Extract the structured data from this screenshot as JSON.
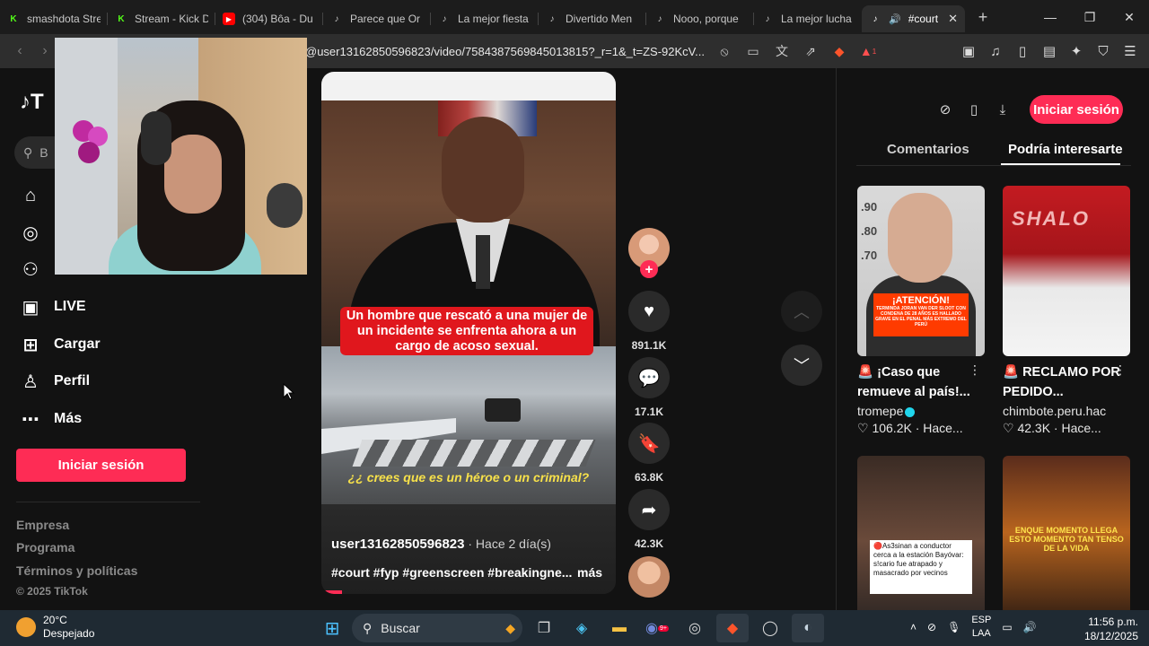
{
  "browser": {
    "tabs": [
      {
        "title": "smashdota Stre",
        "favicon": "kick-icon",
        "color": "#53fc18"
      },
      {
        "title": "Stream - Kick D",
        "favicon": "kick-icon",
        "color": "#53fc18"
      },
      {
        "title": "(304) Bôa - Du",
        "favicon": "youtube-icon",
        "color": "#ff0000"
      },
      {
        "title": "Parece que Or",
        "favicon": "tiktok-icon",
        "color": "#ffffff"
      },
      {
        "title": "La mejor fiesta",
        "favicon": "tiktok-icon",
        "color": "#ffffff"
      },
      {
        "title": "Divertido Men",
        "favicon": "tiktok-icon",
        "color": "#ffffff"
      },
      {
        "title": "Nooo, porque",
        "favicon": "tiktok-icon",
        "color": "#ffffff"
      },
      {
        "title": "La mejor lucha",
        "favicon": "tiktok-icon",
        "color": "#ffffff"
      }
    ],
    "active_tab": {
      "title": "#court",
      "close": "✕"
    },
    "new_tab": "+",
    "url": "@user13162850596823/video/7584387569845013815?_r=1&_t=ZS-92KcV...",
    "brave_badge": "1"
  },
  "sidebar": {
    "logo": "T",
    "search_placeholder": "B",
    "items": [
      {
        "label": "",
        "icon": "home-icon"
      },
      {
        "label": "",
        "icon": "compass-icon"
      },
      {
        "label": "",
        "icon": "following-icon"
      },
      {
        "label": "LIVE",
        "icon": "live-icon"
      },
      {
        "label": "Cargar",
        "icon": "upload-icon"
      },
      {
        "label": "Perfil",
        "icon": "profile-icon"
      },
      {
        "label": "Más",
        "icon": "more-icon"
      }
    ],
    "login_button": "Iniciar sesión",
    "footer": [
      "Empresa",
      "Programa",
      "Términos y políticas"
    ],
    "copyright": "© 2025 TikTok"
  },
  "video": {
    "caption": "Un hombre que rescató a una mujer de un incidente se enfrenta ahora a un cargo de acoso sexual.",
    "question": "¿¿ crees que es un héroe o un criminal?",
    "author": "user13162850596823",
    "posted": " · Hace 2 día(s)",
    "tags": "#court #fyp #greenscreen #breakingne...",
    "more": "más",
    "progress": 0.07
  },
  "actions": {
    "likes": "891.1K",
    "comments": "17.1K",
    "saves": "63.8K",
    "shares": "42.3K"
  },
  "right_panel": {
    "login_button": "Iniciar sesión",
    "tab_comments": "Comentarios",
    "tab_interest": "Podría interesarte",
    "cards": [
      {
        "title": "🚨 ¡Caso que remueve al país!...",
        "user": "tromepe",
        "stats": "♡ 106.2K · Hace...",
        "thumb_text": "¡ATENCIÓN!",
        "thumb_sub": "TERMINDA JORAN VAN DER SLOOT CON CONDENA DE 28 AÑOS ES HALLADO GRAVE EN EL PENAL MÁS EXTREMO DEL PERÚ",
        "nums": [
          ".90",
          ".80",
          ".70"
        ]
      },
      {
        "title": "🚨 RECLAMO POR PEDIDO...",
        "user": "chimbote.peru.hac",
        "stats": "♡ 42.3K · Hace...",
        "thumb_text": "SHALO"
      },
      {
        "title": "",
        "user": "",
        "stats": "",
        "thumb_text": "🔴As3sinan a conductor cerca a la estación Bayóvar: s!cario fue atrapado y masacrado por vecinos"
      },
      {
        "title": "",
        "user": "",
        "stats": "",
        "thumb_text": "ENQUE MOMENTO LLEGA ESTO MOMENTO TAN TENSO DE LA VIDA"
      }
    ]
  },
  "taskbar": {
    "temp": "20°C",
    "weather": "Despejado",
    "search": "Buscar",
    "lang1": "ESP",
    "lang2": "LAA",
    "time": "11:56 p.m.",
    "date": "18/12/2025",
    "discord_badge": "9+"
  }
}
